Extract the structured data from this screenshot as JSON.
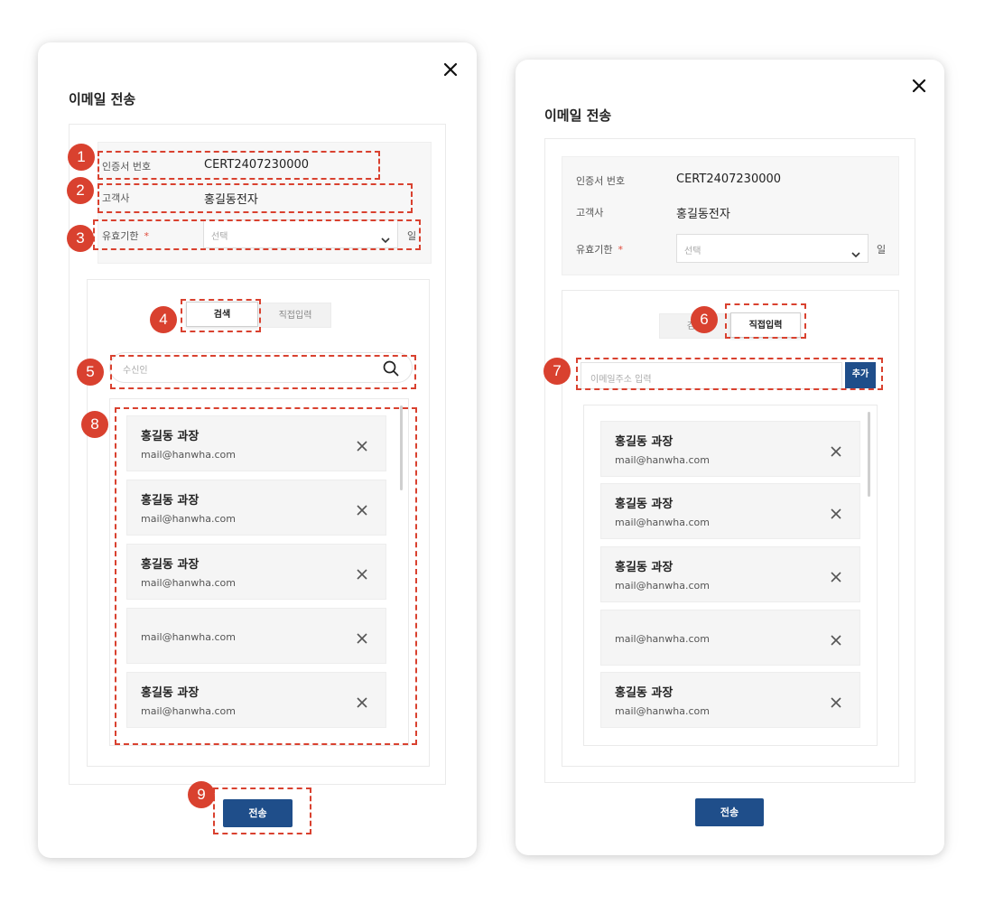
{
  "left_dialog": {
    "title": "이메일 전송",
    "cert_label": "인증서 번호",
    "cert_value": "CERT2407230000",
    "customer_label": "고객사",
    "customer_value": "홍길동전자",
    "validity_label": "유효기한",
    "required_mark": "*",
    "select_placeholder": "선택",
    "unit": "일",
    "tabs": [
      "검색",
      "직접입력"
    ],
    "active_tab": "검색",
    "search_placeholder": "수신인",
    "recipients": [
      {
        "name": "홍길동 과장",
        "email": "mail@hanwha.com"
      },
      {
        "name": "홍길동 과장",
        "email": "mail@hanwha.com"
      },
      {
        "name": "홍길동 과장",
        "email": "mail@hanwha.com"
      },
      {
        "name": "",
        "email": "mail@hanwha.com"
      },
      {
        "name": "홍길동 과장",
        "email": "mail@hanwha.com"
      }
    ],
    "send_label": "전송"
  },
  "right_dialog": {
    "title": "이메일 전송",
    "cert_label": "인증서 번호",
    "cert_value": "CERT2407230000",
    "customer_label": "고객사",
    "customer_value": "홍길동전자",
    "validity_label": "유효기한",
    "required_mark": "*",
    "select_placeholder": "선택",
    "unit": "일",
    "tabs": [
      "검색",
      "직접입력"
    ],
    "active_tab": "직접입력",
    "email_placeholder": "이메일주소 입력",
    "add_label": "추가",
    "recipients": [
      {
        "name": "홍길동 과장",
        "email": "mail@hanwha.com"
      },
      {
        "name": "홍길동 과장",
        "email": "mail@hanwha.com"
      },
      {
        "name": "홍길동 과장",
        "email": "mail@hanwha.com"
      },
      {
        "name": "",
        "email": "mail@hanwha.com"
      },
      {
        "name": "홍길동 과장",
        "email": "mail@hanwha.com"
      }
    ],
    "send_label": "전송"
  },
  "annotations": [
    "1",
    "2",
    "3",
    "4",
    "5",
    "6",
    "7",
    "8",
    "9"
  ],
  "colors": {
    "primary": "#1f4e8a",
    "annotation": "#d9412f",
    "required": "#e04a3b"
  }
}
